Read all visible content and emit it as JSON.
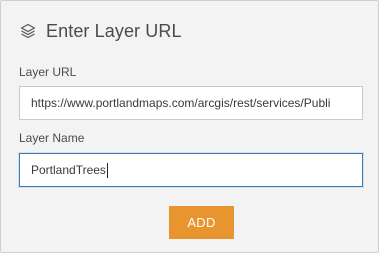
{
  "header": {
    "icon": "layers-icon",
    "title": "Enter Layer URL"
  },
  "url_field": {
    "label": "Layer URL",
    "value": "https://www.portlandmaps.com/arcgis/rest/services/Publi"
  },
  "name_field": {
    "label": "Layer Name",
    "value": "PortlandTrees"
  },
  "actions": {
    "add_label": "ADD"
  },
  "colors": {
    "accent": "#e8942f",
    "focus_border": "#3b7ab8",
    "panel_bg": "#f3f3f3"
  }
}
